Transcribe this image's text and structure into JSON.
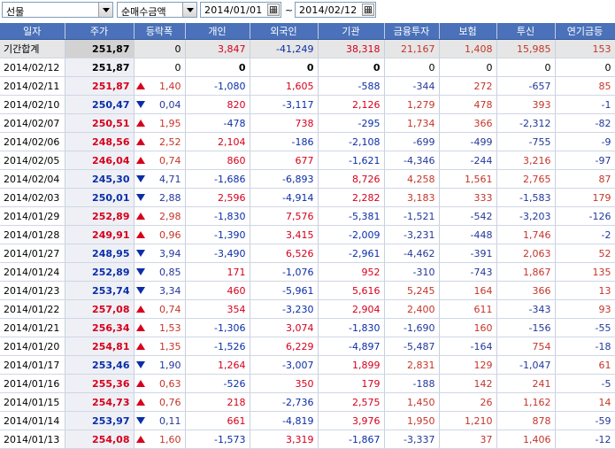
{
  "toolbar": {
    "market_select": "선물",
    "type_select": "순매수금액",
    "date_from": "2014/01/01",
    "date_to": "2014/02/12",
    "tilde": "~"
  },
  "colors": {
    "header_bg": "#4a71b9",
    "up": "#d6001c",
    "down": "#0a2ea8"
  },
  "table": {
    "columns": [
      "일자",
      "주가",
      "등락폭",
      "개인",
      "외국인",
      "기관",
      "금융투자",
      "보험",
      "투신",
      "연기금등"
    ],
    "total_row": {
      "date": "기간합계",
      "price": "251,87",
      "change": "0",
      "individual": "3,847",
      "foreign": "-41,249",
      "institution": "38,318",
      "fin_invest": "21,167",
      "insurance": "1,408",
      "trust": "15,985",
      "pension": "153"
    },
    "rows": [
      {
        "date": "2014/02/12",
        "price": "251,87",
        "dir": "none",
        "change": "0",
        "individual": "0",
        "foreign": "0",
        "institution": "0",
        "fin_invest": "0",
        "insurance": "0",
        "trust": "0",
        "pension": "0"
      },
      {
        "date": "2014/02/11",
        "price": "251,87",
        "dir": "up",
        "change": "1,40",
        "individual": "-1,080",
        "foreign": "1,605",
        "institution": "-588",
        "fin_invest": "-344",
        "insurance": "272",
        "trust": "-657",
        "pension": "85"
      },
      {
        "date": "2014/02/10",
        "price": "250,47",
        "dir": "down",
        "change": "0,04",
        "individual": "820",
        "foreign": "-3,117",
        "institution": "2,126",
        "fin_invest": "1,279",
        "insurance": "478",
        "trust": "393",
        "pension": "-1"
      },
      {
        "date": "2014/02/07",
        "price": "250,51",
        "dir": "up",
        "change": "1,95",
        "individual": "-478",
        "foreign": "738",
        "institution": "-295",
        "fin_invest": "1,734",
        "insurance": "366",
        "trust": "-2,312",
        "pension": "-82"
      },
      {
        "date": "2014/02/06",
        "price": "248,56",
        "dir": "up",
        "change": "2,52",
        "individual": "2,104",
        "foreign": "-186",
        "institution": "-2,108",
        "fin_invest": "-699",
        "insurance": "-499",
        "trust": "-755",
        "pension": "-9"
      },
      {
        "date": "2014/02/05",
        "price": "246,04",
        "dir": "up",
        "change": "0,74",
        "individual": "860",
        "foreign": "677",
        "institution": "-1,621",
        "fin_invest": "-4,346",
        "insurance": "-244",
        "trust": "3,216",
        "pension": "-97"
      },
      {
        "date": "2014/02/04",
        "price": "245,30",
        "dir": "down",
        "change": "4,71",
        "individual": "-1,686",
        "foreign": "-6,893",
        "institution": "8,726",
        "fin_invest": "4,258",
        "insurance": "1,561",
        "trust": "2,765",
        "pension": "87"
      },
      {
        "date": "2014/02/03",
        "price": "250,01",
        "dir": "down",
        "change": "2,88",
        "individual": "2,596",
        "foreign": "-4,914",
        "institution": "2,282",
        "fin_invest": "3,183",
        "insurance": "333",
        "trust": "-1,583",
        "pension": "179"
      },
      {
        "date": "2014/01/29",
        "price": "252,89",
        "dir": "up",
        "change": "2,98",
        "individual": "-1,830",
        "foreign": "7,576",
        "institution": "-5,381",
        "fin_invest": "-1,521",
        "insurance": "-542",
        "trust": "-3,203",
        "pension": "-126"
      },
      {
        "date": "2014/01/28",
        "price": "249,91",
        "dir": "up",
        "change": "0,96",
        "individual": "-1,390",
        "foreign": "3,415",
        "institution": "-2,009",
        "fin_invest": "-3,231",
        "insurance": "-448",
        "trust": "1,746",
        "pension": "-2"
      },
      {
        "date": "2014/01/27",
        "price": "248,95",
        "dir": "down",
        "change": "3,94",
        "individual": "-3,490",
        "foreign": "6,526",
        "institution": "-2,961",
        "fin_invest": "-4,462",
        "insurance": "-391",
        "trust": "2,063",
        "pension": "52"
      },
      {
        "date": "2014/01/24",
        "price": "252,89",
        "dir": "down",
        "change": "0,85",
        "individual": "171",
        "foreign": "-1,076",
        "institution": "952",
        "fin_invest": "-310",
        "insurance": "-743",
        "trust": "1,867",
        "pension": "135"
      },
      {
        "date": "2014/01/23",
        "price": "253,74",
        "dir": "down",
        "change": "3,34",
        "individual": "460",
        "foreign": "-5,961",
        "institution": "5,616",
        "fin_invest": "5,245",
        "insurance": "164",
        "trust": "366",
        "pension": "13"
      },
      {
        "date": "2014/01/22",
        "price": "257,08",
        "dir": "up",
        "change": "0,74",
        "individual": "354",
        "foreign": "-3,230",
        "institution": "2,904",
        "fin_invest": "2,400",
        "insurance": "611",
        "trust": "-343",
        "pension": "93"
      },
      {
        "date": "2014/01/21",
        "price": "256,34",
        "dir": "up",
        "change": "1,53",
        "individual": "-1,306",
        "foreign": "3,074",
        "institution": "-1,830",
        "fin_invest": "-1,690",
        "insurance": "160",
        "trust": "-156",
        "pension": "-55"
      },
      {
        "date": "2014/01/20",
        "price": "254,81",
        "dir": "up",
        "change": "1,35",
        "individual": "-1,526",
        "foreign": "6,229",
        "institution": "-4,897",
        "fin_invest": "-5,487",
        "insurance": "-164",
        "trust": "754",
        "pension": "-18"
      },
      {
        "date": "2014/01/17",
        "price": "253,46",
        "dir": "down",
        "change": "1,90",
        "individual": "1,264",
        "foreign": "-3,007",
        "institution": "1,899",
        "fin_invest": "2,831",
        "insurance": "129",
        "trust": "-1,047",
        "pension": "61"
      },
      {
        "date": "2014/01/16",
        "price": "255,36",
        "dir": "up",
        "change": "0,63",
        "individual": "-526",
        "foreign": "350",
        "institution": "179",
        "fin_invest": "-188",
        "insurance": "142",
        "trust": "241",
        "pension": "-5"
      },
      {
        "date": "2014/01/15",
        "price": "254,73",
        "dir": "up",
        "change": "0,76",
        "individual": "218",
        "foreign": "-2,736",
        "institution": "2,575",
        "fin_invest": "1,450",
        "insurance": "26",
        "trust": "1,162",
        "pension": "14"
      },
      {
        "date": "2014/01/14",
        "price": "253,97",
        "dir": "down",
        "change": "0,11",
        "individual": "661",
        "foreign": "-4,819",
        "institution": "3,976",
        "fin_invest": "1,950",
        "insurance": "1,210",
        "trust": "878",
        "pension": "-59"
      },
      {
        "date": "2014/01/13",
        "price": "254,08",
        "dir": "up",
        "change": "1,60",
        "individual": "-1,573",
        "foreign": "3,319",
        "institution": "-1,867",
        "fin_invest": "-3,337",
        "insurance": "37",
        "trust": "1,406",
        "pension": "-12"
      }
    ]
  }
}
